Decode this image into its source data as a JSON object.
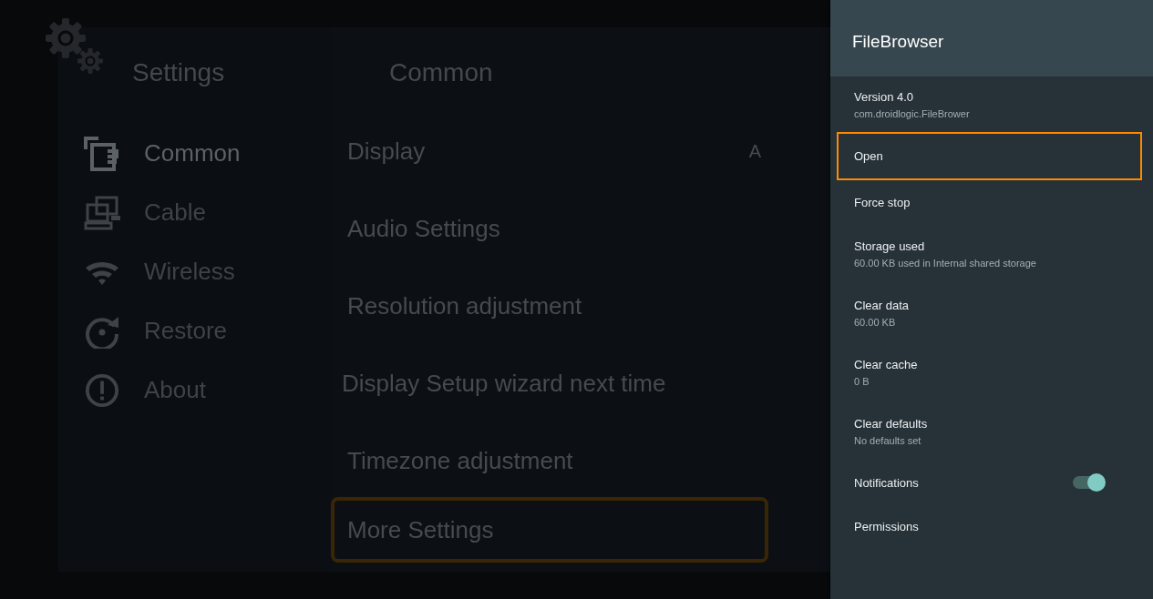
{
  "settings": {
    "title": "Settings",
    "nav": [
      {
        "label": "Common",
        "selected": true
      },
      {
        "label": "Cable",
        "selected": false
      },
      {
        "label": "Wireless",
        "selected": false
      },
      {
        "label": "Restore",
        "selected": false
      },
      {
        "label": "About",
        "selected": false
      }
    ]
  },
  "common": {
    "title": "Common",
    "rows": [
      {
        "label": "Display",
        "value": "A",
        "selected": false
      },
      {
        "label": "Audio Settings",
        "selected": false
      },
      {
        "label": "Resolution adjustment",
        "selected": false
      },
      {
        "label": "Display Setup wizard next time",
        "selected": false
      },
      {
        "label": "Timezone adjustment",
        "selected": false
      },
      {
        "label": "More Settings",
        "selected": true
      }
    ]
  },
  "drawer": {
    "title": "FileBrowser",
    "items": [
      {
        "kind": "info",
        "title": "Version 4.0",
        "subtitle": "com.droidlogic.FileBrower",
        "selected": false
      },
      {
        "kind": "action",
        "title": "Open",
        "selected": true
      },
      {
        "kind": "action",
        "title": "Force stop",
        "selected": false
      },
      {
        "kind": "action",
        "title": "Storage used",
        "subtitle": "60.00 KB used in Internal shared storage",
        "selected": false
      },
      {
        "kind": "action",
        "title": "Clear data",
        "subtitle": "60.00 KB",
        "selected": false
      },
      {
        "kind": "action",
        "title": "Clear cache",
        "subtitle": "0 B",
        "selected": false
      },
      {
        "kind": "action",
        "title": "Clear defaults",
        "subtitle": "No defaults set",
        "selected": false
      },
      {
        "kind": "toggle",
        "title": "Notifications",
        "on": true,
        "selected": false
      },
      {
        "kind": "action",
        "title": "Permissions",
        "selected": false
      }
    ]
  }
}
